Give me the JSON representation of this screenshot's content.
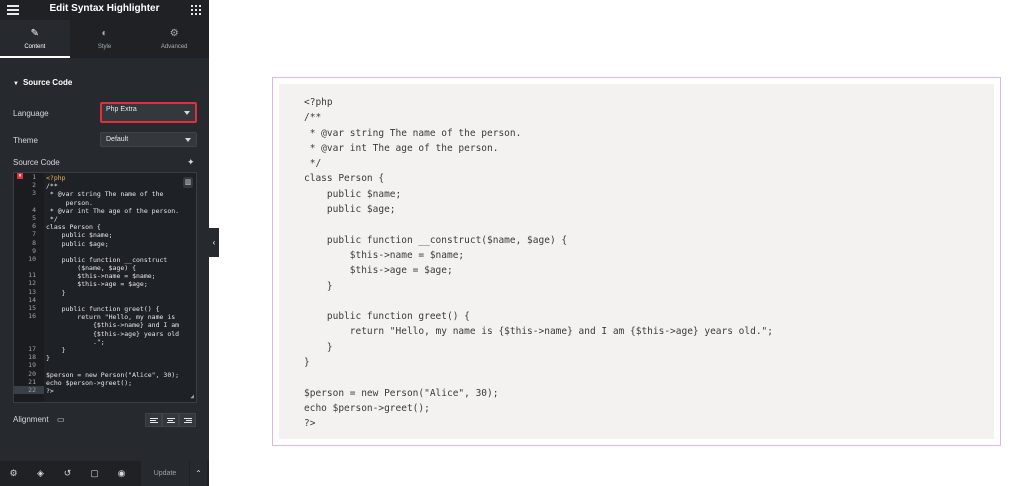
{
  "topbar": {
    "title": "Edit Syntax Highlighter"
  },
  "tabs": [
    {
      "label": "Content",
      "icon": "pencil-icon",
      "glyph": "✎"
    },
    {
      "label": "Style",
      "icon": "contrast-icon",
      "glyph": "◐"
    },
    {
      "label": "Advanced",
      "icon": "gear-icon",
      "glyph": "⚙"
    }
  ],
  "section": {
    "title": "Source Code"
  },
  "language": {
    "label": "Language",
    "value": "Php Extra"
  },
  "theme": {
    "label": "Theme",
    "value": "Default"
  },
  "source": {
    "label": "Source Code"
  },
  "editor": {
    "gutter": [
      "1",
      "2",
      "3",
      "",
      "4",
      "5",
      "6",
      "7",
      "8",
      "9",
      "10",
      "",
      "11",
      "12",
      "13",
      "14",
      "15",
      "16",
      "",
      "",
      "",
      "17",
      "18",
      "19",
      "20",
      "21",
      "22"
    ],
    "lines": [
      "<?php",
      "/**",
      " * @var string The name of the",
      "     person.",
      " * @var int The age of the person.",
      " */",
      "class Person {",
      "    public $name;",
      "    public $age;",
      "",
      "    public function __construct",
      "        ($name, $age) {",
      "        $this->name = $name;",
      "        $this->age = $age;",
      "    }",
      "",
      "    public function greet() {",
      "        return \"Hello, my name is",
      "            {$this->name} and I am",
      "            {$this->age} years old",
      "            .\";",
      "    }",
      "}",
      "",
      "$person = new Person(\"Alice\", 30);",
      "echo $person->greet();",
      "?>"
    ]
  },
  "alignment": {
    "label": "Alignment"
  },
  "footer": {
    "update_label": "Update"
  },
  "preview": {
    "lines": [
      "<?php",
      "/**",
      " * @var string The name of the person.",
      " * @var int The age of the person.",
      " */",
      "class Person {",
      "    public $name;",
      "    public $age;",
      "",
      "    public function __construct($name, $age) {",
      "        $this->name = $name;",
      "        $this->age = $age;",
      "    }",
      "",
      "    public function greet() {",
      "        return \"Hello, my name is {$this->name} and I am {$this->age} years old.\";",
      "    }",
      "}",
      "",
      "$person = new Person(\"Alice\", 30);",
      "echo $person->greet();",
      "?>"
    ]
  },
  "colors": {
    "sidebar_bg": "#26292e",
    "highlight_border": "#e0303a",
    "preview_border": "#e3b4ec",
    "preview_bg": "#f4f2f0"
  }
}
